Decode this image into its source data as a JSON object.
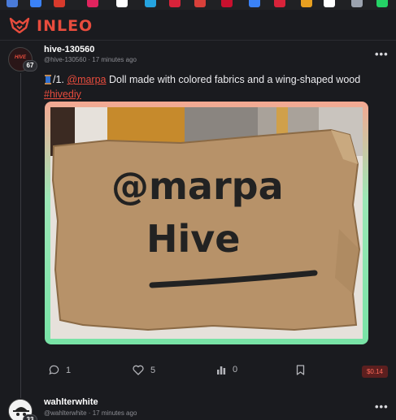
{
  "app": {
    "logo_text": "INLEO",
    "brand_color": "#e84c3d"
  },
  "bookmarks": [
    {
      "icon": "gmail-icon",
      "color": "#4a7bd8"
    },
    {
      "icon": "chrome-extension-icon",
      "color": "#3b82f6"
    },
    {
      "icon": "red-app-icon",
      "color": "#d83a2c"
    },
    {
      "icon": "tiktok-icon",
      "color": "#e0245e"
    },
    {
      "icon": "x-icon",
      "color": "#ffffff"
    },
    {
      "icon": "app-icon",
      "color": "#25a4e0"
    },
    {
      "icon": "shield-icon",
      "color": "#d8233a"
    },
    {
      "icon": "arrow-icon",
      "color": "#d8403a"
    },
    {
      "icon": "badge-icon",
      "color": "#c8102e"
    },
    {
      "icon": "flag-icon",
      "color": "#3b82f6"
    },
    {
      "icon": "media-icon",
      "color": "#d8233a"
    },
    {
      "icon": "stripe-icon",
      "color": "#e8a020"
    },
    {
      "icon": "x-icon",
      "color": "#ffffff"
    },
    {
      "icon": "moon-icon",
      "color": "#9ca3af"
    },
    {
      "icon": "whatsapp-icon",
      "color": "#25d366"
    }
  ],
  "post": {
    "author": "hive-130560",
    "handle": "@hive-130560",
    "time": "17 minutes ago",
    "meta": "@hive-130560 · 17 minutes ago",
    "avatar_text": "HIVE",
    "reputation": "67",
    "body_prefix": "/1. ",
    "mention": "@marpa",
    "body_text": " Doll made with colored fabrics and a wing-shaped wood",
    "hashtag": "#hivediy",
    "media_text_line1": "@marpa",
    "media_text_line2": "Hive",
    "comments": "1",
    "likes": "5",
    "votes": "0",
    "payout": "$0.14"
  },
  "next_post": {
    "author": "wahlterwhite",
    "meta": "@wahlterwhite · 17 minutes ago",
    "reputation": "33"
  }
}
